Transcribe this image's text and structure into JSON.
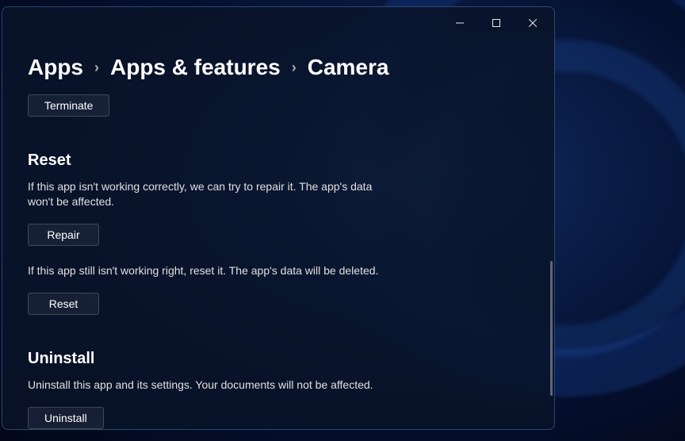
{
  "breadcrumb": {
    "level1": "Apps",
    "level2": "Apps & features",
    "level3": "Camera"
  },
  "terminate_button": "Terminate",
  "reset_section": {
    "title": "Reset",
    "repair_desc": "If this app isn't working correctly, we can try to repair it. The app's data won't be affected.",
    "repair_button": "Repair",
    "reset_desc": "If this app still isn't working right, reset it. The app's data will be deleted.",
    "reset_button": "Reset"
  },
  "uninstall_section": {
    "title": "Uninstall",
    "desc": "Uninstall this app and its settings. Your documents will not be affected.",
    "button": "Uninstall"
  }
}
